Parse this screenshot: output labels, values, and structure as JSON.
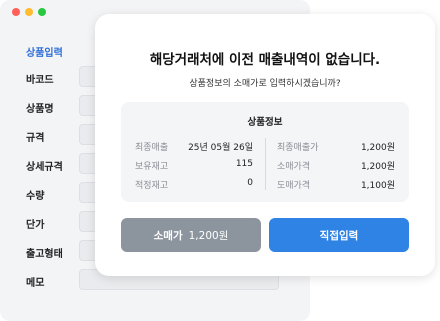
{
  "colors": {
    "dot_red": "#ff5f57",
    "dot_yellow": "#febc2e",
    "dot_green": "#28c840",
    "accent_blue": "#2f83e4",
    "button_gray": "#8c949e"
  },
  "form": {
    "fields": [
      {
        "label": "상품입력",
        "active": true
      },
      {
        "label": "바코드"
      },
      {
        "label": "상품명"
      },
      {
        "label": "규격"
      },
      {
        "label": "상세규격"
      },
      {
        "label": "수량"
      },
      {
        "label": "단가"
      },
      {
        "label": "출고형태"
      },
      {
        "label": "메모"
      }
    ]
  },
  "modal": {
    "title": "해당거래처에 이전 매출내역이 없습니다.",
    "subtitle": "상품정보의 소매가로 입력하시겠습니까?",
    "info": {
      "title": "상품정보",
      "left": [
        {
          "label": "최종매출",
          "value": "25년 05월 26일"
        },
        {
          "label": "보유재고",
          "value": "115"
        },
        {
          "label": "적정재고",
          "value": "0"
        }
      ],
      "right": [
        {
          "label": "최종매출가",
          "value": "1,200원"
        },
        {
          "label": "소매가격",
          "value": "1,200원"
        },
        {
          "label": "도매가격",
          "value": "1,100원"
        }
      ]
    },
    "buttons": {
      "retail_label": "소매가",
      "retail_price": "1,200원",
      "direct_label": "직접입력"
    }
  }
}
